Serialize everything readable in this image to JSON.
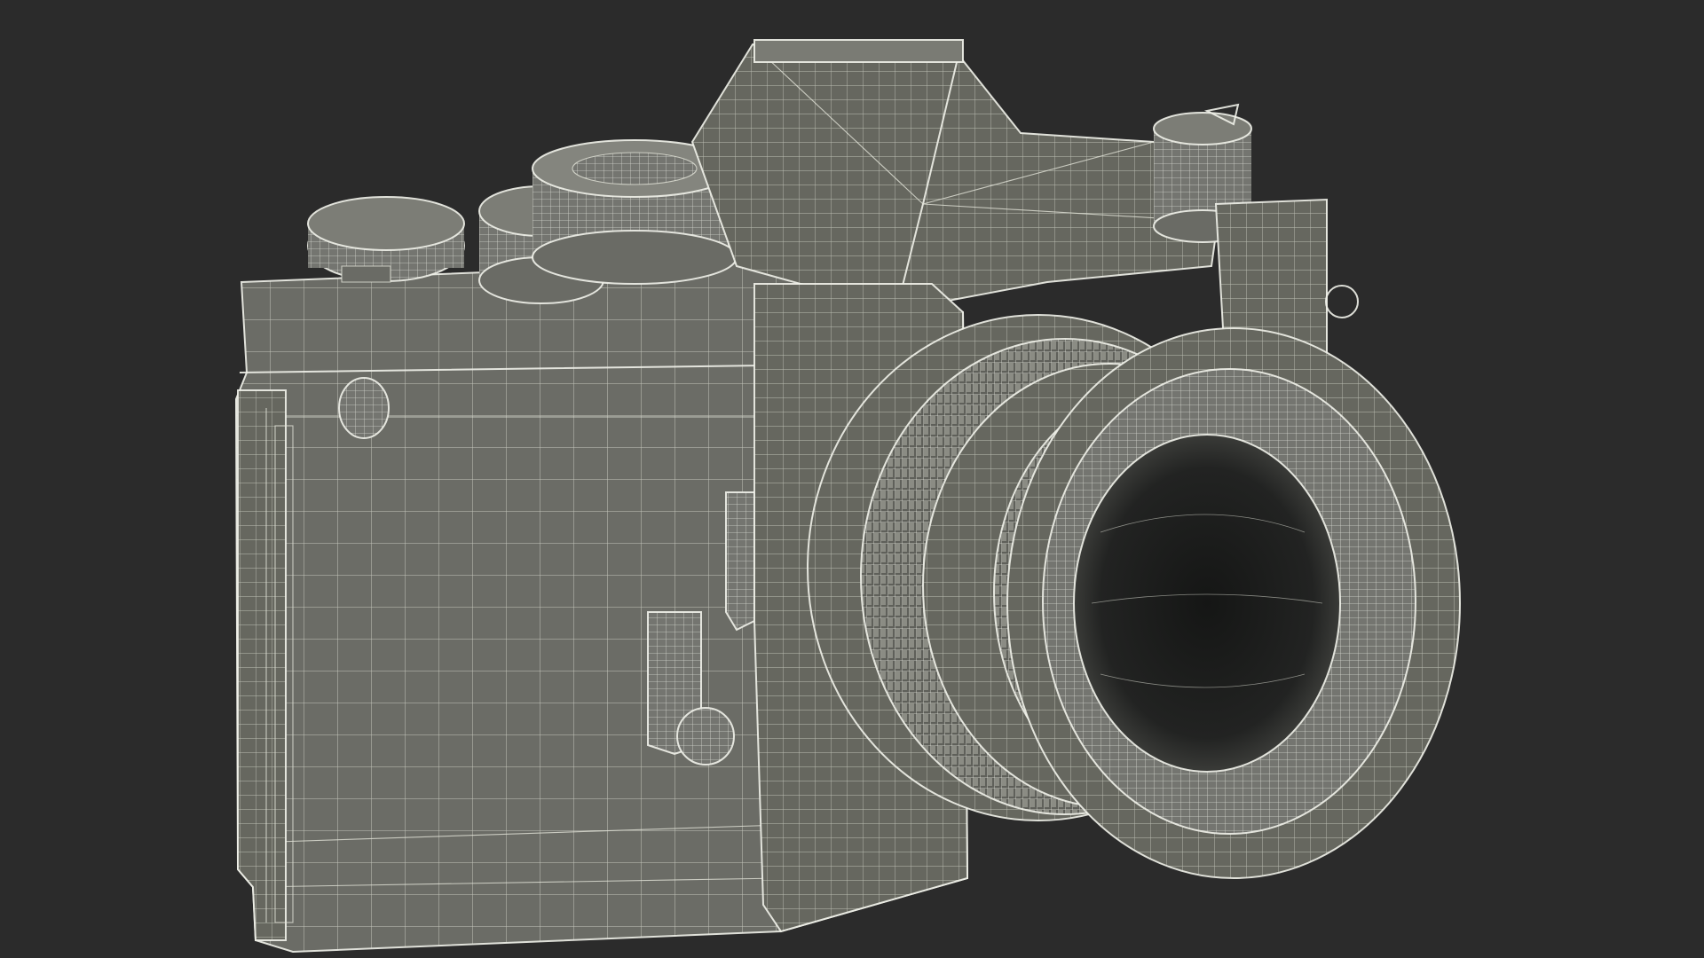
{
  "scene": {
    "subject": "camera-wireframe-model",
    "background_color": "#2b2b2b",
    "mesh_fill_color": "#6e6f69",
    "mesh_dark_color": "#5a5b56",
    "wire_color": "#e2e4d8",
    "lens_interior_color": "#1c1d1c"
  }
}
